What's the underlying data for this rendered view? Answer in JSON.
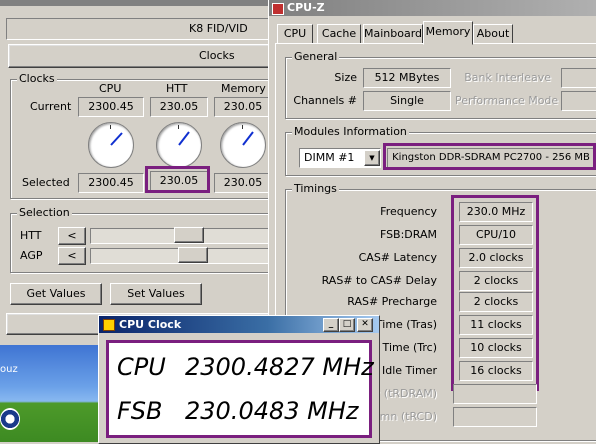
{
  "k8": {
    "title": "K8 FID/VID",
    "clocks_tab": "Clocks",
    "clocks_group": "Clocks",
    "col_cpu": "CPU",
    "col_htt": "HTT",
    "col_memory": "Memory",
    "current_label": "Current",
    "current_cpu": "2300.45",
    "current_htt": "230.05",
    "current_mem": "230.05",
    "selected_label": "Selected",
    "selected_cpu": "2300.45",
    "selected_htt": "230.05",
    "selected_mem": "230.05",
    "selection_group": "Selection",
    "htt_label": "HTT",
    "agp_label": "AGP",
    "left_arrow": "<",
    "get_values": "Get Values",
    "set_values": "Set Values"
  },
  "cpuz": {
    "title": "CPU-Z",
    "tabs": [
      "CPU",
      "Cache",
      "Mainboard",
      "Memory",
      "About"
    ],
    "active_tab": "Memory",
    "general_group": "General",
    "size_label": "Size",
    "size_value": "512 MBytes",
    "channels_label": "Channels #",
    "channels_value": "Single",
    "bank_label": "Bank Interleave",
    "perf_label": "Performance Mode",
    "modules_group": "Modules Information",
    "dimm_select": "DIMM #1",
    "module_value": "Kingston DDR-SDRAM PC2700 - 256 MB",
    "timings_group": "Timings",
    "timings": [
      {
        "label": "Frequency",
        "value": "230.0 MHz"
      },
      {
        "label": "FSB:DRAM",
        "value": "CPU/10"
      },
      {
        "label": "CAS# Latency",
        "value": "2.0 clocks"
      },
      {
        "label": "RAS# to CAS# Delay",
        "value": "2 clocks"
      },
      {
        "label": "RAS# Precharge",
        "value": "2 clocks"
      },
      {
        "label": "e Time (Tras)",
        "value": "11 clocks"
      },
      {
        "label": "e Time (Trc)",
        "value": "10 clocks"
      },
      {
        "label": "M Idle Timer",
        "value": "16 clocks"
      }
    ],
    "faded_1": "# (tRDRAM)",
    "faded_2": "umn (tRCD)"
  },
  "cpuclock": {
    "title": "CPU Clock",
    "cpu_label": "CPU",
    "cpu_value": "2300.4827 MHz",
    "fsb_label": "FSB",
    "fsb_value": "230.0483 MHz"
  },
  "desktop": {
    "partial_text": "ouz"
  },
  "colors": {
    "highlight": "#7a1f7f",
    "titlebar_active": "#0a246a",
    "titlebar_inactive": "#808080"
  }
}
